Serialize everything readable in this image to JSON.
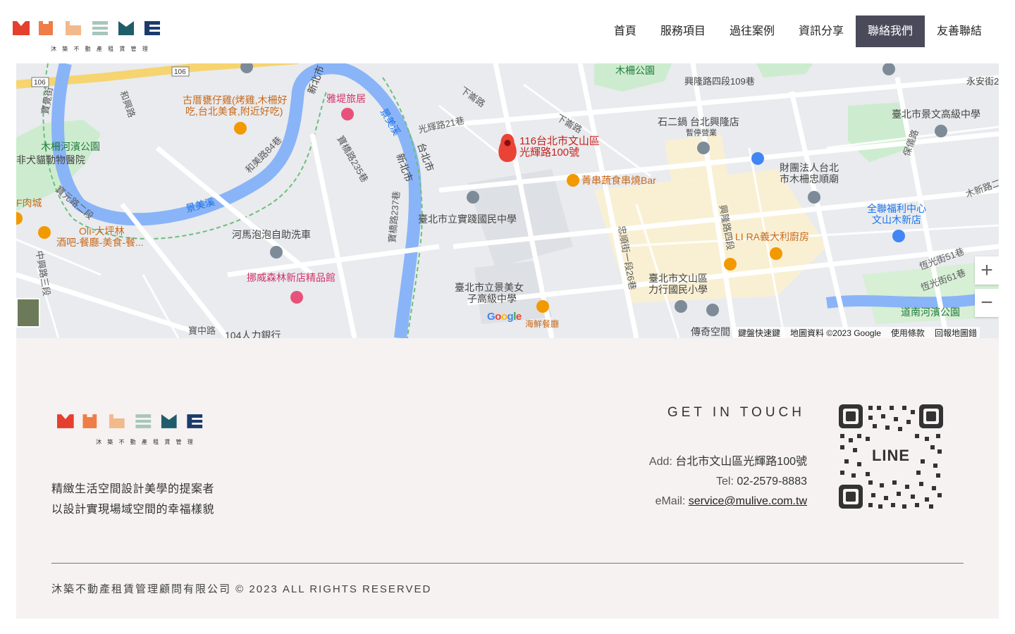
{
  "brand": {
    "subtitle": "沐 築 不 動 產 租 賃 管 理",
    "colors": [
      "#e4402f",
      "#ee7d47",
      "#f2b98b",
      "#a8c6bb",
      "#1f5d6b",
      "#1b3b6b"
    ]
  },
  "nav": {
    "items": [
      {
        "label": "首頁"
      },
      {
        "label": "服務項目"
      },
      {
        "label": "過往案例"
      },
      {
        "label": "資訊分享"
      },
      {
        "label": "聯絡我們",
        "active": true
      },
      {
        "label": "友善聯結"
      }
    ]
  },
  "map": {
    "pin_address_line1": "116台北市文山區",
    "pin_address_line2": "光輝路100號",
    "labels": {
      "muzha_park": "木柵公園",
      "xinglong_rd": "興隆路四段109巷",
      "yongan_st": "永安街2",
      "restaurant1_line1": "古厝甕仔雞(烤雞,木柵好",
      "restaurant1_line2": "吃,台北美食,附近好吃)",
      "hotel": "雅堤旅居",
      "jingmei_river": "景美溪",
      "xinbei_city": "新北市",
      "taibei_city": "台北市",
      "muzha_riverside": "木柵河濱公園",
      "animal_hospital": "非犬貓動物醫院",
      "jingmei_creek2": "景美溪",
      "shijian_school": "臺北市立實踐國民中學",
      "skewer_bar": "菁串蔬食串燒Bar",
      "hotpot_line1": "石二鍋 台北興隆店",
      "hotpot_line2": "暫停營業",
      "jingwen_school": "臺北市景文高級中學",
      "temple_line1": "財團法人台北",
      "temple_line2": "市木柵忠順廟",
      "pxmart_line1": "全聯福利中心",
      "pxmart_line2": "文山木新店",
      "carwash": "河馬泡泡自助洗車",
      "bakery": "挪威森林新店精品館",
      "oli_line1": "Olí-大坪林",
      "oli_line2": "酒吧-餐廳-美食-餐...",
      "meat": "F肉城",
      "jingmei_girls_line1": "臺北市立景美女",
      "jingmei_girls_line2": "子高級中學",
      "seafood": "海鮮餐廳",
      "lira": "LI RA義大利廚房",
      "lixing_line1": "臺北市文山區",
      "lixing_line2": "力行國民小學",
      "daonan_park": "道南河濱公園",
      "chuanqi": "傳奇空間",
      "bank": "104人力銀行",
      "road_guanghui21": "光輝路21巷",
      "road_xiazhang": "下崙路",
      "road_xiazhang2": "下崙路",
      "road_baoqiao235": "寶橋路235巷",
      "road_baoqiao237": "寶橋路237巷",
      "road_hemei84": "和美路84巷",
      "road_heyu": "和興路",
      "road_baoyuan": "寶元路二段",
      "road_zhongxing": "中興路三段",
      "road_baozhong": "寶中路",
      "road_zhongshun": "忠順街一段26巷",
      "road_xinglong4": "興隆路四段",
      "road_hengguang51": "恆光街51巷",
      "road_hengguang61": "恆光街61巷",
      "road_muxin": "木新路二",
      "road_baoxing": "保儀路",
      "road_yunmao": "寶覺街"
    },
    "route_shields": [
      "106",
      "106"
    ],
    "attribution": {
      "shortcuts": "鍵盤快速鍵",
      "data": "地圖資料 ©2023 Google",
      "terms": "使用條款",
      "report": "回報地圖錯"
    },
    "zoom_in": "+",
    "zoom_out": "−"
  },
  "footer": {
    "tagline_line1": "精緻生活空間設計美學的提案者",
    "tagline_line2": "以設計實現場域空間的幸福樣貌",
    "get_in_touch": "GET IN TOUCH",
    "address_label": "Add:",
    "address_value": "台北市文山區光輝路100號",
    "tel_label": "Tel:",
    "tel_value": "02-2579-8883",
    "email_label": "eMail:",
    "email_value": "service@mulive.com.tw",
    "qr_label": "LINE",
    "copyright": "沐築不動產租賃管理顧問有限公司 © 2023 ALL RIGHTS RESERVED"
  }
}
